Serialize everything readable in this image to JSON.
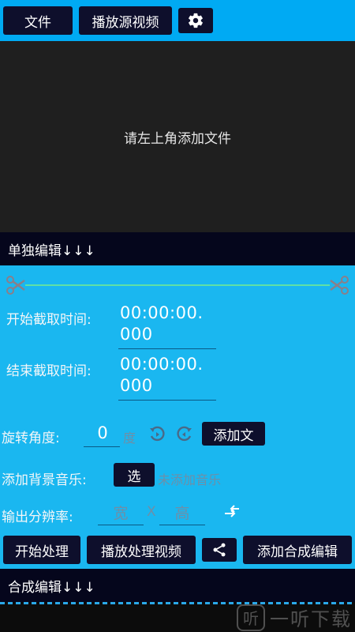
{
  "toolbar": {
    "file_label": "文件",
    "play_source_label": "播放源视频"
  },
  "preview": {
    "hint": "请左上角添加文件"
  },
  "single_edit": {
    "title": "单独编辑↓↓↓"
  },
  "clip": {
    "start_label": "开始截取时间:",
    "start_value_line1": "00:00:00.",
    "start_value_line2": "000",
    "end_label": "结束截取时间:",
    "end_value_line1": "00:00:00.",
    "end_value_line2": "000"
  },
  "rotate": {
    "label": "旋转角度:",
    "value": "0",
    "unit": "度",
    "add_text_label": "添加文"
  },
  "music": {
    "label": "添加背景音乐:",
    "select_label": "选",
    "status": "未添加音乐"
  },
  "resolution": {
    "label": "输出分辨率:",
    "width_placeholder": "宽",
    "separator": "X",
    "height_placeholder": "高"
  },
  "actions": {
    "start_label": "开始处理",
    "play_processed_label": "播放处理视频",
    "add_merge_label": "添加合成编辑"
  },
  "merge_edit": {
    "title": "合成编辑↓↓↓"
  },
  "watermark": {
    "text": "一听下载",
    "logo": "听"
  }
}
